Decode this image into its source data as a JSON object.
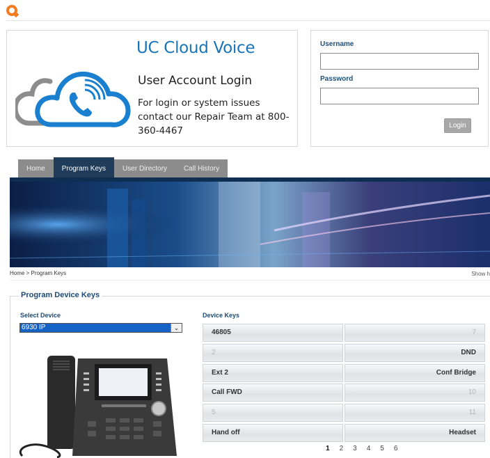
{
  "brand": {
    "title": "UC Cloud Voice",
    "subtitle": "User Account Login",
    "info": "For login or system issues contact our Repair Team at 800-360-4467"
  },
  "login": {
    "username_label": "Username",
    "username_value": "",
    "password_label": "Password",
    "password_value": "",
    "button_label": "Login"
  },
  "nav": {
    "tabs": [
      "Home",
      "Program Keys",
      "User Directory",
      "Call History"
    ],
    "active": "Program Keys"
  },
  "breadcrumb": {
    "home": "Home",
    "sep": ">",
    "current": "Program Keys"
  },
  "show_link": "Show h",
  "section": {
    "title": "Program Device Keys",
    "select_label": "Select Device",
    "selected_device": "6930 IP",
    "device_keys_label": "Device Keys"
  },
  "device_keys": {
    "left": [
      "46805",
      "2",
      "Ext 2",
      "Call FWD",
      "5",
      "Hand off"
    ],
    "right": [
      "7",
      "DND",
      "Conf Bridge",
      "10",
      "11",
      "Headset"
    ]
  },
  "pagination": {
    "pages": [
      "1",
      "2",
      "3",
      "4",
      "5",
      "6"
    ],
    "current": "1"
  },
  "colors": {
    "accent": "#1a74b8",
    "nav_dark": "#1f3c5a",
    "logo": "#f47b20"
  },
  "icons": {
    "logo": "chat-logo-icon",
    "cloud": "cloud-phone-icon"
  }
}
